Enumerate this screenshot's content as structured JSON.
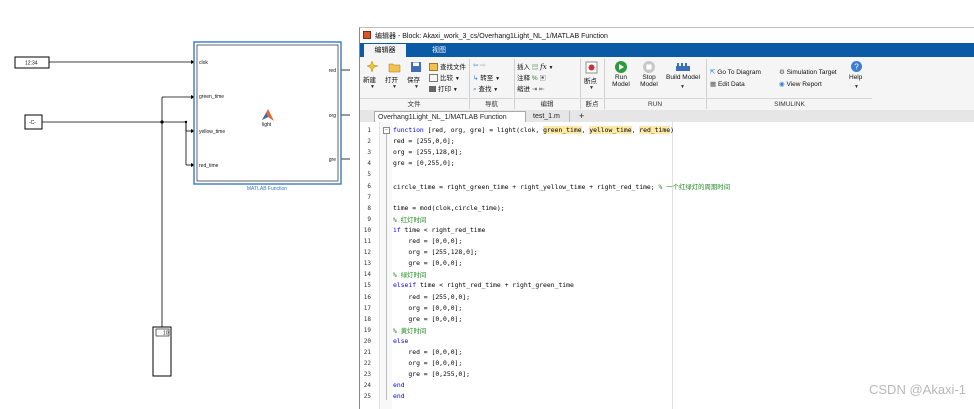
{
  "simulink": {
    "clock_display": "12:34",
    "constant_label": "-C-",
    "display_value": "10",
    "block_caption": "MATLAB Function",
    "block_name": "light",
    "inputs": [
      "clok",
      "green_time",
      "yellow_time",
      "red_time"
    ],
    "outputs": [
      "red",
      "org",
      "gre"
    ]
  },
  "editor": {
    "title": "编辑器 - Block: Akaxi_work_3_cs/Overhang1Light_NL_1/MATLAB Function",
    "tabs": [
      "编辑器",
      "视图"
    ],
    "ribbon": {
      "file": {
        "new": "新建",
        "open": "打开",
        "save": "保存",
        "find_files": "查找文件",
        "compare": "比较",
        "print": "打印",
        "section": "文件"
      },
      "navigate": {
        "goto": "转至",
        "find": "查找",
        "section": "导航"
      },
      "edit": {
        "insert": "插入",
        "comment": "注释",
        "indent": "缩进",
        "section": "编辑"
      },
      "breakpoints": {
        "label": "断点",
        "section": "断点"
      },
      "run": {
        "run_model": "Run Model",
        "stop_model": "Stop Model",
        "build_model": "Build Model",
        "section": "RUN"
      },
      "simulink": {
        "goto_diagram": "Go To Diagram",
        "edit_data": "Edit Data",
        "sim_target": "Simulation Target",
        "view_report": "View Report",
        "help": "Help",
        "section": "SIMULINK"
      }
    },
    "file_tabs": [
      "Overhang1Light_NL_1/MATLAB Function",
      "test_1.m",
      "+"
    ],
    "code_lines": [
      {
        "n": "1",
        "parts": [
          {
            "t": "function",
            "c": "kw"
          },
          {
            "t": " [red, org, gre] = light(clok, "
          },
          {
            "t": "green_time",
            "c": "hl"
          },
          {
            "t": ", "
          },
          {
            "t": "yellow_time",
            "c": "hl"
          },
          {
            "t": ", "
          },
          {
            "t": "red_time",
            "c": "hl"
          },
          {
            "t": ")"
          }
        ]
      },
      {
        "n": "2",
        "parts": [
          {
            "t": "red = [255,0,0];"
          }
        ]
      },
      {
        "n": "3",
        "parts": [
          {
            "t": "org = [255,128,0];"
          }
        ]
      },
      {
        "n": "4",
        "parts": [
          {
            "t": "gre = [0,255,0];"
          }
        ]
      },
      {
        "n": "5",
        "parts": [
          {
            "t": ""
          }
        ]
      },
      {
        "n": "6",
        "parts": [
          {
            "t": "circle_time = right_green_time + right_yellow_time + right_red_time; "
          },
          {
            "t": "% 一个红绿灯的周期时间",
            "c": "cm"
          }
        ]
      },
      {
        "n": "7",
        "parts": [
          {
            "t": ""
          }
        ]
      },
      {
        "n": "8",
        "parts": [
          {
            "t": "time = mod(clok,circle_time);"
          }
        ]
      },
      {
        "n": "9",
        "parts": [
          {
            "t": "% 红灯时间",
            "c": "cm"
          }
        ]
      },
      {
        "n": "10",
        "parts": [
          {
            "t": "if",
            "c": "kw"
          },
          {
            "t": " time < right_red_time"
          }
        ]
      },
      {
        "n": "11",
        "parts": [
          {
            "t": "    red = [0,0,0];"
          }
        ]
      },
      {
        "n": "12",
        "parts": [
          {
            "t": "    org = [255,128,0];"
          }
        ]
      },
      {
        "n": "13",
        "parts": [
          {
            "t": "    gre = [0,0,0];"
          }
        ]
      },
      {
        "n": "14",
        "parts": [
          {
            "t": "% 绿灯时间",
            "c": "cm"
          }
        ]
      },
      {
        "n": "15",
        "parts": [
          {
            "t": "elseif",
            "c": "kw"
          },
          {
            "t": " time < right_red_time + right_green_time"
          }
        ]
      },
      {
        "n": "16",
        "parts": [
          {
            "t": "    red = [255,0,0];"
          }
        ]
      },
      {
        "n": "17",
        "parts": [
          {
            "t": "    org = [0,0,0];"
          }
        ]
      },
      {
        "n": "18",
        "parts": [
          {
            "t": "    gre = [0,0,0];"
          }
        ]
      },
      {
        "n": "19",
        "parts": [
          {
            "t": "% 黄灯时间",
            "c": "cm"
          }
        ]
      },
      {
        "n": "20",
        "parts": [
          {
            "t": "else",
            "c": "kw"
          }
        ]
      },
      {
        "n": "21",
        "parts": [
          {
            "t": "    red = [0,0,0];"
          }
        ]
      },
      {
        "n": "22",
        "parts": [
          {
            "t": "    org = [0,0,0];"
          }
        ]
      },
      {
        "n": "23",
        "parts": [
          {
            "t": "    gre = [0,255,0];"
          }
        ]
      },
      {
        "n": "24",
        "parts": [
          {
            "t": "end",
            "c": "kw"
          }
        ]
      },
      {
        "n": "25",
        "parts": [
          {
            "t": "end",
            "c": "kw"
          }
        ]
      }
    ]
  },
  "watermark": "CSDN @Akaxi-1",
  "colors": {
    "tab_bar": "#0b5aa5",
    "block_border": "#3a77c9",
    "keyword": "#0000ff",
    "comment": "#228b22",
    "highlight": "#ffe9a6"
  }
}
